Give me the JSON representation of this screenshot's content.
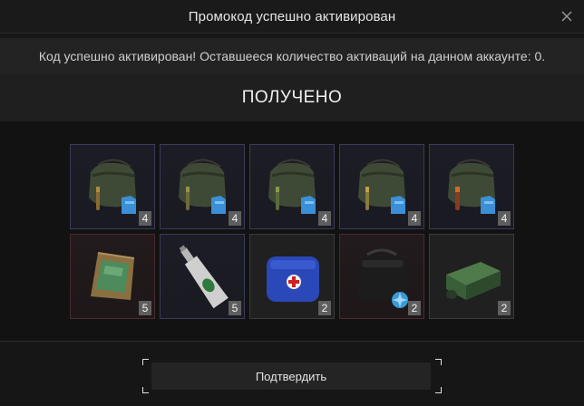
{
  "dialog": {
    "title": "Промокод успешно активирован",
    "close_icon": "close-icon",
    "message": "Код успешно активирован! Оставшееся количество активаций на данном аккаунте: 0.",
    "received_heading": "ПОЛУЧЕНО",
    "confirm_label": "Подтвердить"
  },
  "items": [
    {
      "icon": "bag-with-armor-ammo-icon",
      "quantity": "4",
      "rarity": "blue",
      "accent": "#4fa3e6"
    },
    {
      "icon": "bag-with-armor-ammo-icon",
      "quantity": "4",
      "rarity": "blue",
      "accent": "#4fa3e6"
    },
    {
      "icon": "bag-with-armor-ammo-icon",
      "quantity": "4",
      "rarity": "blue",
      "accent": "#4fa3e6"
    },
    {
      "icon": "bag-with-armor-ammo-icon",
      "quantity": "4",
      "rarity": "blue",
      "accent": "#4fa3e6"
    },
    {
      "icon": "bag-with-armor-ammo-icon",
      "quantity": "4",
      "rarity": "blue",
      "accent": "#4fa3e6"
    },
    {
      "icon": "ration-pack-icon",
      "quantity": "5",
      "rarity": "red"
    },
    {
      "icon": "bottle-icon",
      "quantity": "5",
      "rarity": "blue"
    },
    {
      "icon": "medkit-bag-icon",
      "quantity": "2",
      "rarity": "grey"
    },
    {
      "icon": "black-bag-icon",
      "quantity": "2",
      "rarity": "red"
    },
    {
      "icon": "green-crate-icon",
      "quantity": "2",
      "rarity": "grey"
    }
  ]
}
